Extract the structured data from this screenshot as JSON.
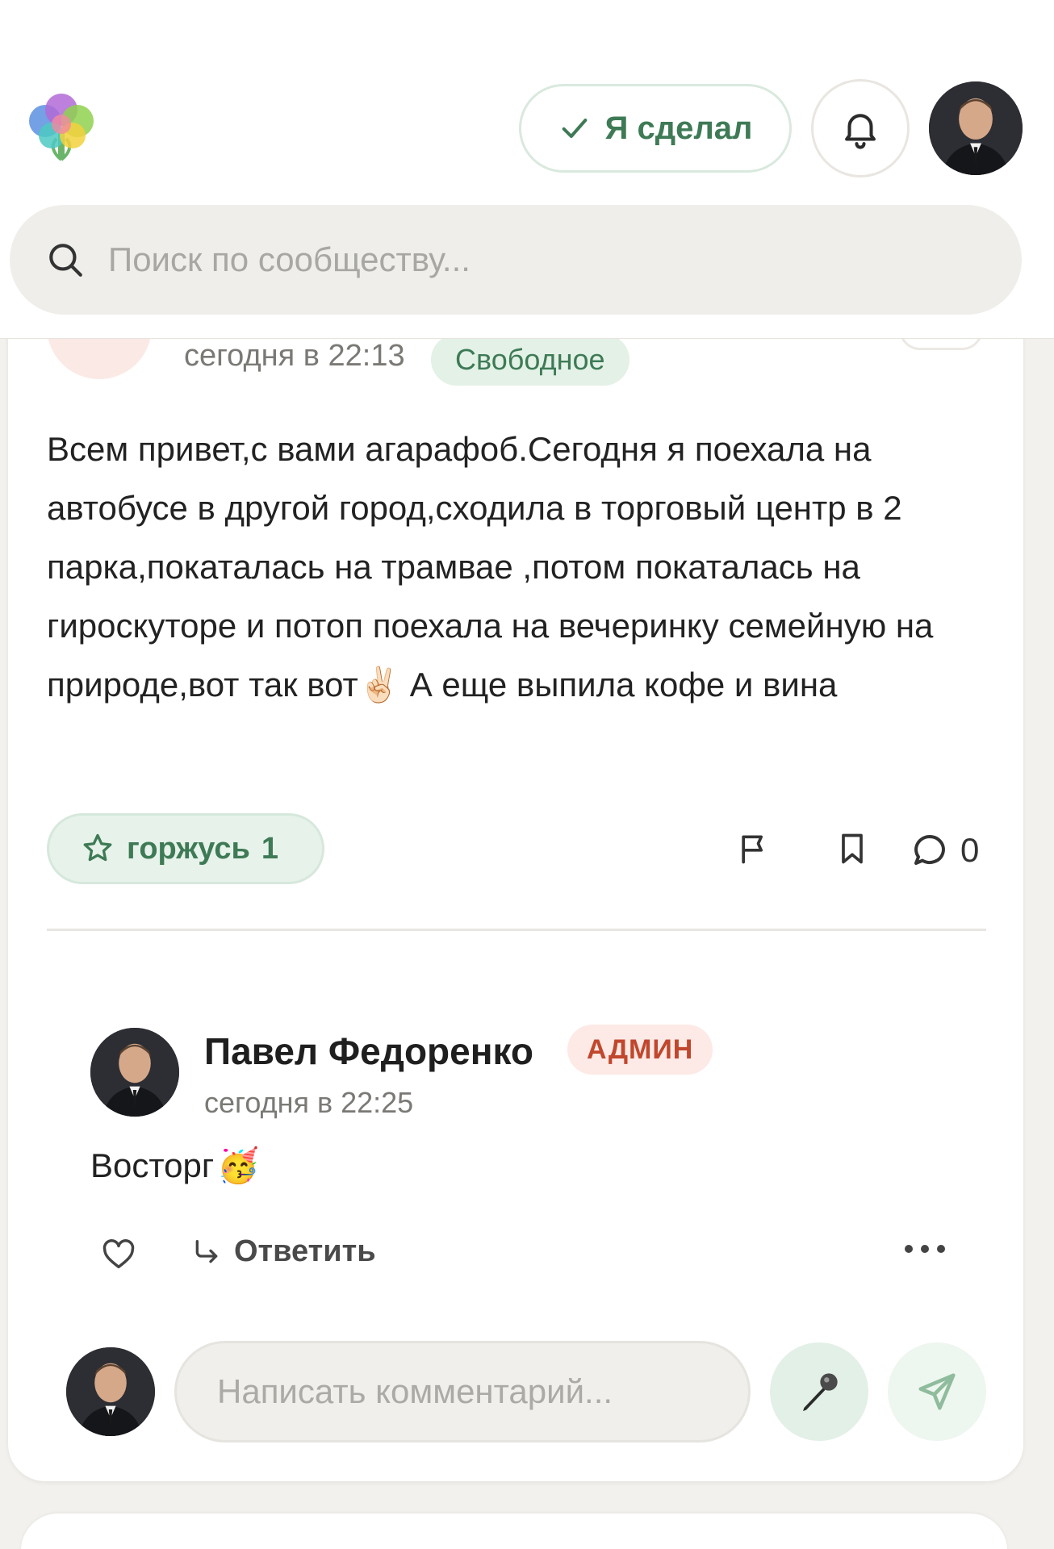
{
  "header": {
    "done_label": "Я сделал",
    "search_placeholder": "Поиск по сообществу..."
  },
  "post": {
    "time": "сегодня в 22:13",
    "category": "Свободное",
    "text_before_emoji": "Всем привет,с вами агарафоб.Сегодня я поехала на автобусе в другой город,сходила в торговый центр в 2 парка,покаталась на трамвае ,потом покаталась на гироскуторе и потоп поехала на вечеринку семейную на природе,вот так вот",
    "emoji": "✌🏻",
    "text_after_emoji": " А еще выпила кофе и вина",
    "proud_label": "горжусь",
    "proud_count": "1",
    "comment_count": "0"
  },
  "comment": {
    "author": "Павел Федоренко",
    "badge": "АДМИН",
    "time": "сегодня в 22:25",
    "text": "Восторг",
    "emoji": "🥳",
    "reply_label": "Ответить"
  },
  "composer": {
    "placeholder": "Написать комментарий..."
  },
  "colors": {
    "accent_green": "#3e7a55",
    "admin_red": "#c0472d",
    "background": "#f3f1ed"
  }
}
